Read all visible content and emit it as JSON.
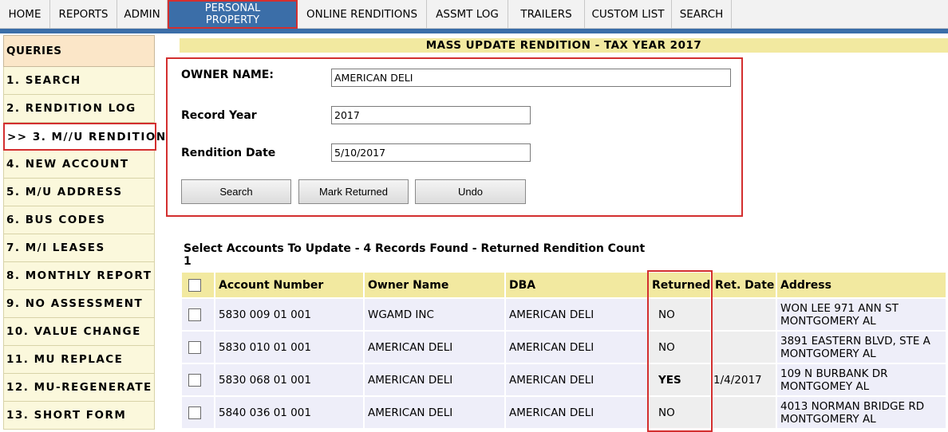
{
  "nav": {
    "tabs": [
      {
        "label": "HOME"
      },
      {
        "label": "REPORTS"
      },
      {
        "label": "ADMIN"
      },
      {
        "label_line1": "PERSONAL",
        "label_line2": "PROPERTY"
      },
      {
        "label": "ONLINE RENDITIONS"
      },
      {
        "label": "ASSMT LOG"
      },
      {
        "label": "TRAILERS"
      },
      {
        "label": "CUSTOM LIST"
      },
      {
        "label": "SEARCH"
      }
    ]
  },
  "sidebar": {
    "header": "QUERIES",
    "items": [
      "1. SEARCH",
      "2. RENDITION LOG",
      ">> 3. M//U RENDITION",
      "4. NEW ACCOUNT",
      "5. M/U ADDRESS",
      "6. BUS CODES",
      "7. M/I LEASES",
      "8. MONTHLY REPORT",
      "9. NO ASSESSMENT",
      "10. VALUE CHANGE",
      "11. MU REPLACE",
      "12. MU-REGENERATE",
      "13. SHORT FORM"
    ]
  },
  "banner": "MASS UPDATE RENDITION - TAX YEAR 2017",
  "form": {
    "owner_label": "OWNER NAME:",
    "owner_value": "AMERICAN DELI",
    "year_label": "Record Year",
    "year_value": "2017",
    "date_label": "Rendition Date",
    "date_value": "5/10/2017",
    "search_btn": "Search",
    "mark_btn": "Mark Returned",
    "undo_btn": "Undo"
  },
  "results": {
    "line1": "Select Accounts To Update -  4 Records Found - Returned Rendition Count",
    "line2": "1"
  },
  "table": {
    "headers": {
      "account": "Account Number",
      "owner": "Owner Name",
      "dba": "DBA",
      "returned": "Returned",
      "ret_date": "Ret. Date",
      "address": "Address"
    },
    "rows": [
      {
        "account": "5830 009 01 001",
        "owner": "WGAMD INC",
        "dba": "AMERICAN DELI",
        "returned": "NO",
        "ret_date": "",
        "addr1": "WON LEE  971 ANN ST",
        "addr2": "MONTGOMERY AL"
      },
      {
        "account": "5830 010 01 001",
        "owner": "AMERICAN DELI",
        "dba": "AMERICAN DELI",
        "returned": "NO",
        "ret_date": "",
        "addr1": " 3891 EASTERN BLVD, STE A",
        "addr2": "MONTGOMERY AL"
      },
      {
        "account": "5830 068 01 001",
        "owner": "AMERICAN DELI",
        "dba": "AMERICAN DELI",
        "returned": "YES",
        "ret_date": "1/4/2017",
        "addr1": " 109 N BURBANK DR",
        "addr2": "MONTGOMEY AL"
      },
      {
        "account": "5840 036 01 001",
        "owner": "AMERICAN DELI",
        "dba": "AMERICAN DELI",
        "returned": "NO",
        "ret_date": "",
        "addr1": " 4013 NORMAN BRIDGE RD",
        "addr2": "MONTGOMERY AL"
      }
    ]
  }
}
